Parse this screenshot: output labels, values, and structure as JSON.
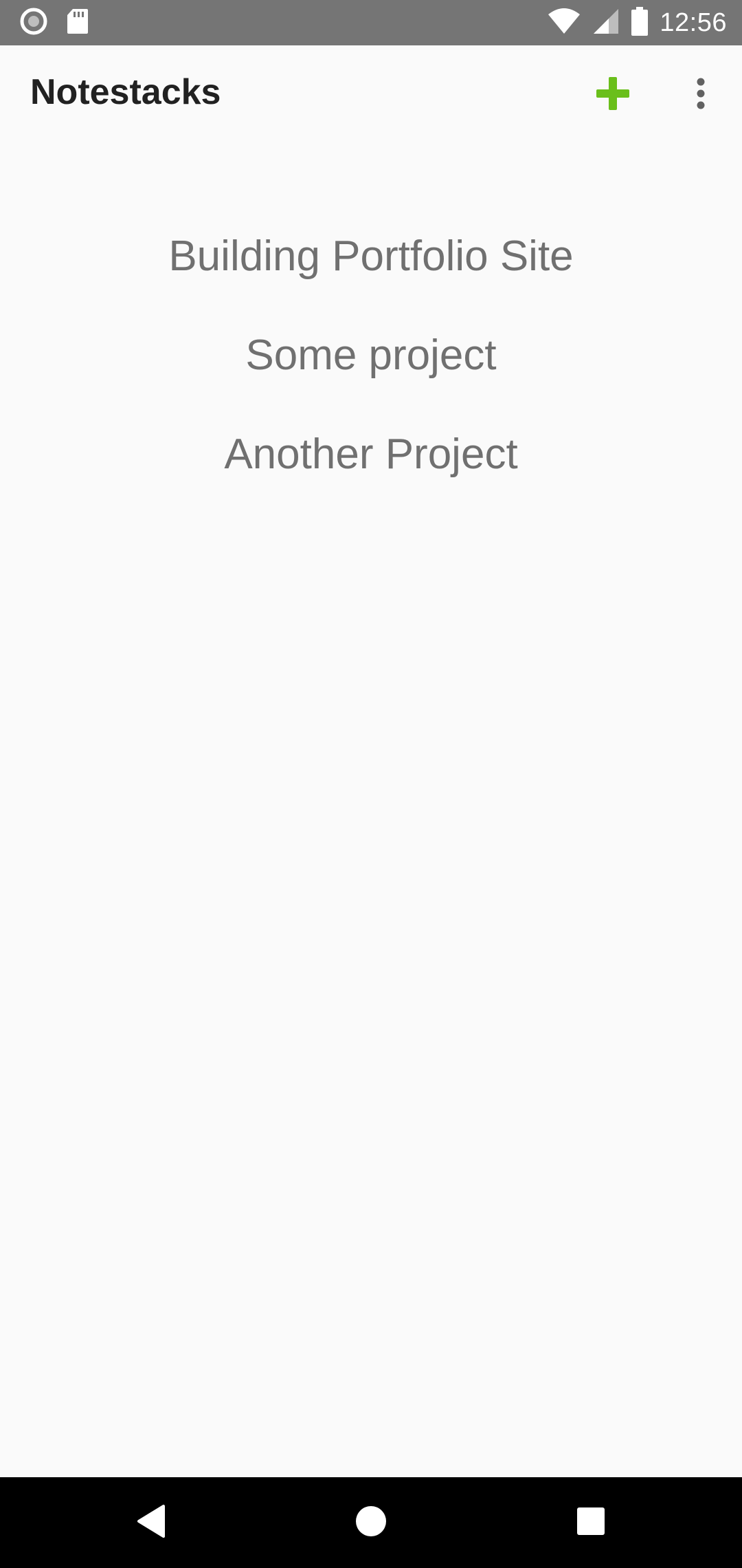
{
  "status_bar": {
    "time": "12:56",
    "icons": [
      "record-icon",
      "sd-card-icon",
      "wifi-icon",
      "signal-icon",
      "battery-icon"
    ]
  },
  "app_bar": {
    "title": "Notestacks",
    "add_icon": "plus-icon",
    "add_color": "#6abf1b",
    "overflow_icon": "more-vert-icon"
  },
  "projects": [
    {
      "label": "Building Portfolio Site"
    },
    {
      "label": "Some project"
    },
    {
      "label": "Another Project"
    }
  ],
  "nav_bar": {
    "icons": [
      "back-icon",
      "home-icon",
      "recents-icon"
    ]
  }
}
